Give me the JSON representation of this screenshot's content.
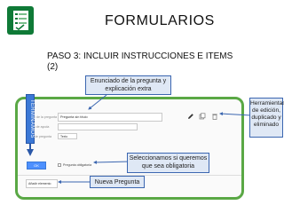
{
  "slide": {
    "title": "FORMULARIOS",
    "subtitle": "PASO 3: INCLUIR INSTRUCCIONES E ITEMS (2)"
  },
  "callouts": {
    "question_text": "Enunciado de la pregunta y explicación extra",
    "tools": "Herramientas de edición, duplicado y eliminado",
    "required": "Seleccionamos si queremos que sea obligatoria",
    "new_question": "Nueva Pregunta"
  },
  "vertical_label": "TERMINAMOS",
  "form": {
    "question_title_label": "Título de la pregunta",
    "question_title_value": "Pregunta sin título",
    "help_text_label": "Texto de ayuda",
    "question_type_label": "Tipo de pregunta",
    "question_type_value": "Texto",
    "ok_label": "OK",
    "required_label": "Pregunta obligatoria",
    "add_item_label": "Añadir elemento"
  },
  "colors": {
    "green_frame": "#5aa845",
    "callout_bg": "#dfe8f5",
    "callout_border": "#3b66b0",
    "ok_button": "#4d90fe"
  }
}
